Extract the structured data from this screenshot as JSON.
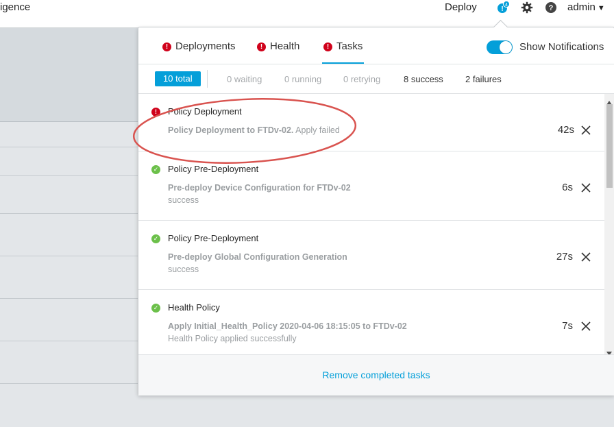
{
  "topbar": {
    "brand": "igence",
    "deploy_label": "Deploy",
    "notification_badge": "4",
    "admin_label": "admin"
  },
  "tabs": [
    {
      "label": "Deployments",
      "status": "error"
    },
    {
      "label": "Health",
      "status": "error"
    },
    {
      "label": "Tasks",
      "status": "error",
      "active": true
    }
  ],
  "show_notifications": {
    "label": "Show Notifications",
    "on": true
  },
  "filters": {
    "total": "10 total",
    "waiting": "0 waiting",
    "running": "0 running",
    "retrying": "0 retrying",
    "success": "8 success",
    "failures": "2 failures"
  },
  "tasks": [
    {
      "status": "error",
      "title": "Policy Deployment",
      "desc_bold": "Policy Deployment to FTDv-02.",
      "desc_rest": " Apply failed",
      "sub": "",
      "duration": "42s"
    },
    {
      "status": "success",
      "title": "Policy Pre-Deployment",
      "desc_bold": "Pre-deploy Device Configuration for FTDv-02",
      "desc_rest": "",
      "sub": "success",
      "duration": "6s"
    },
    {
      "status": "success",
      "title": "Policy Pre-Deployment",
      "desc_bold": "Pre-deploy Global Configuration Generation",
      "desc_rest": "",
      "sub": "success",
      "duration": "27s"
    },
    {
      "status": "success",
      "title": "Health Policy",
      "desc_bold": "Apply Initial_Health_Policy 2020-04-06 18:15:05 to FTDv-02",
      "desc_rest": "",
      "sub": "Health Policy applied successfully",
      "duration": "7s"
    }
  ],
  "footer": {
    "remove_label": "Remove completed tasks"
  },
  "colors": {
    "accent": "#049fd9",
    "error": "#d0021b",
    "success": "#6cc04a",
    "annotation": "#d9534f"
  }
}
